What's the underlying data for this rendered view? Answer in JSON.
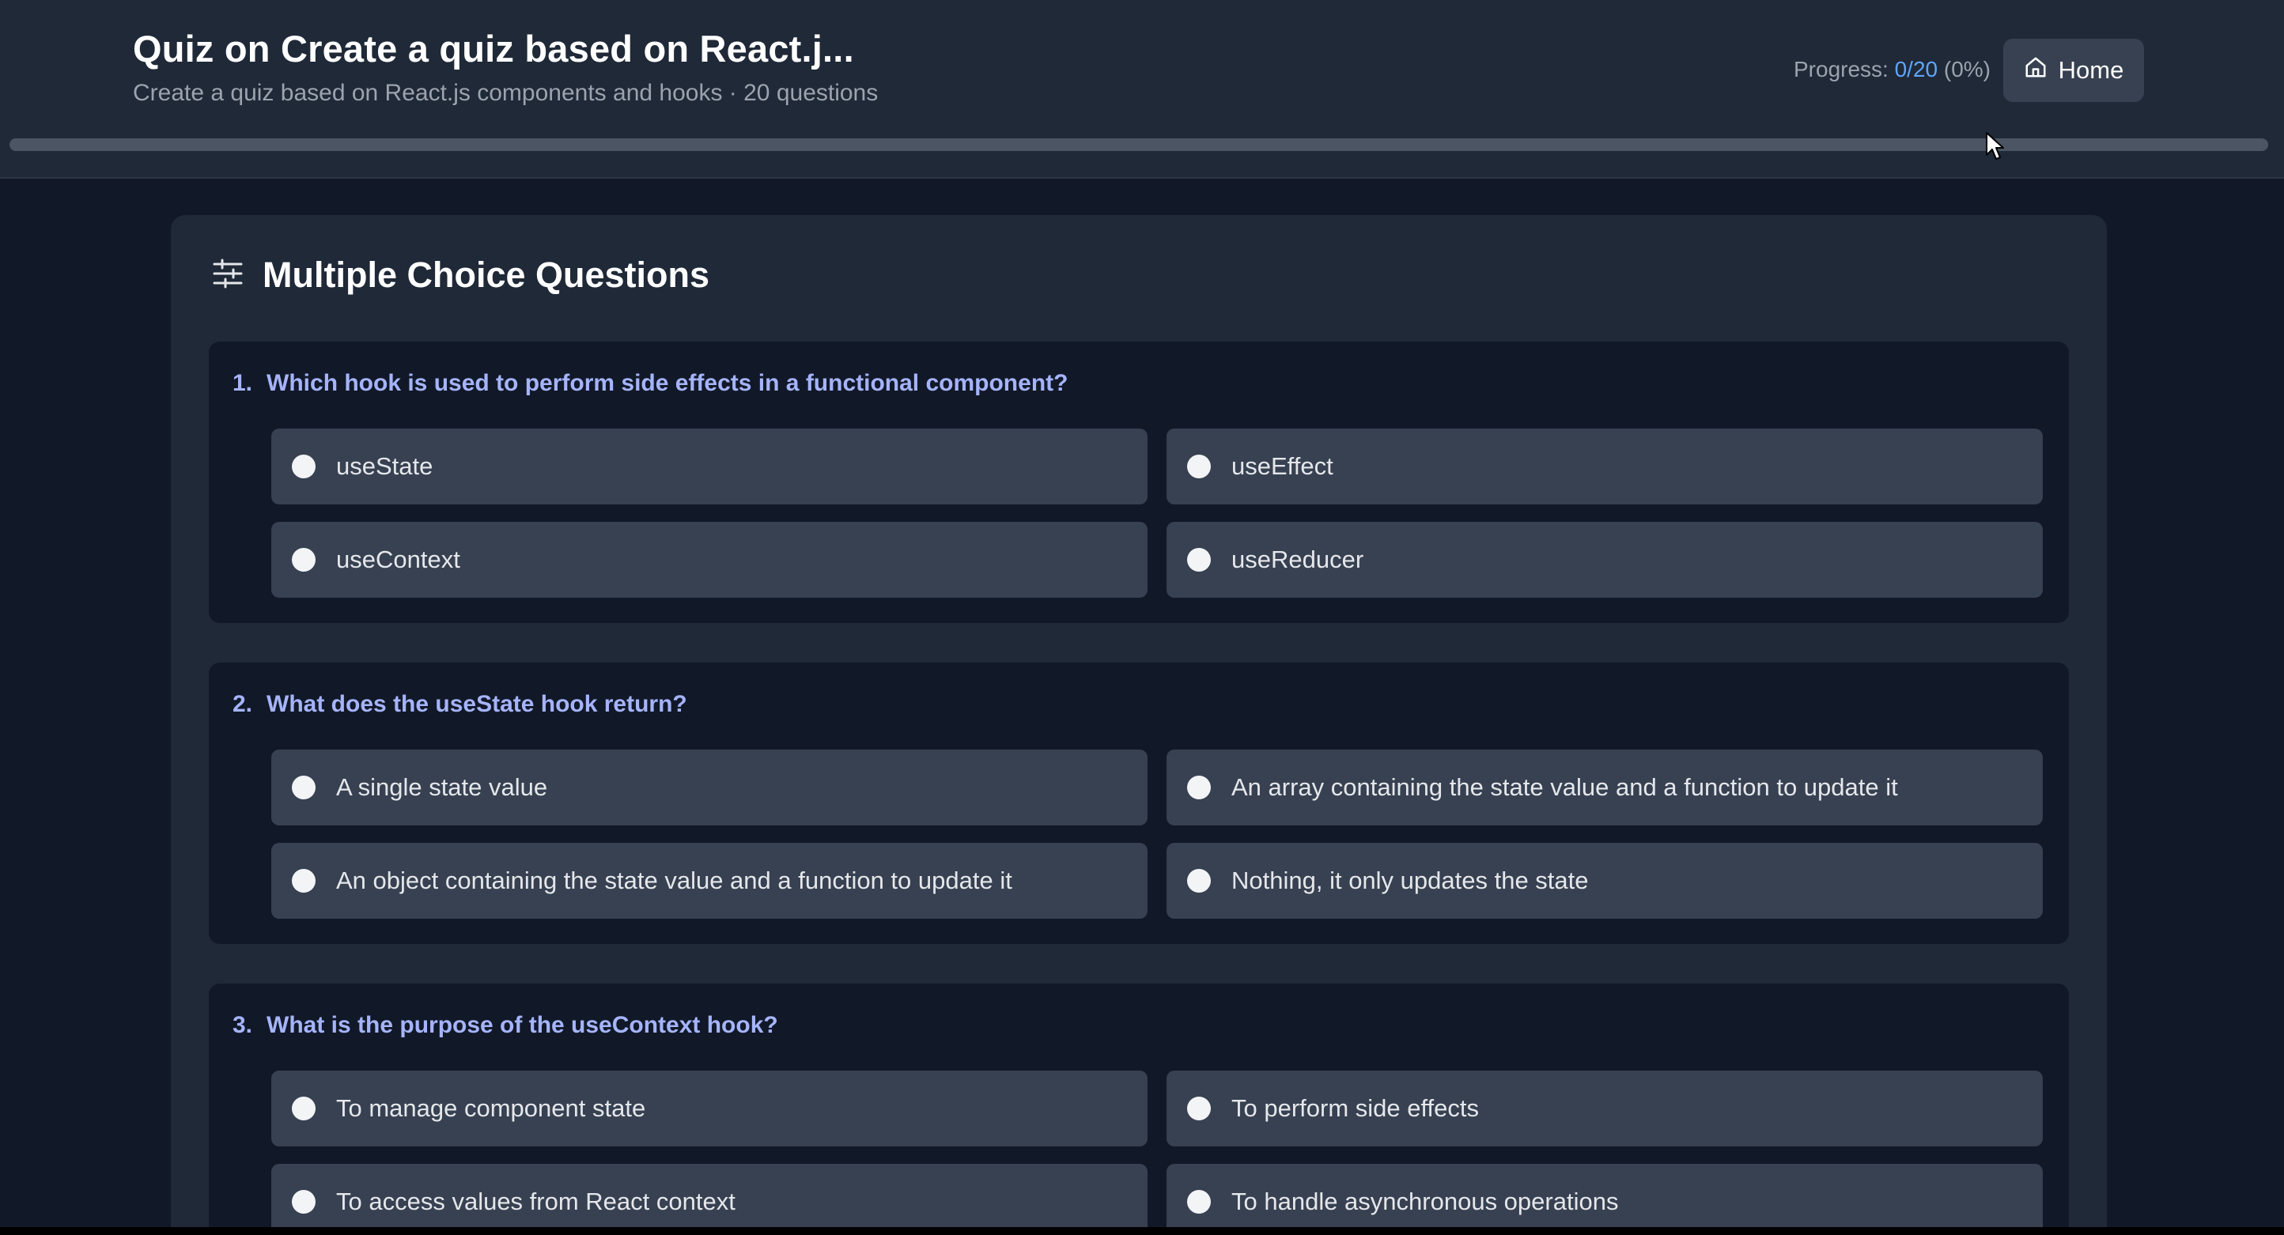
{
  "header": {
    "title": "Quiz on Create a quiz based on React.j...",
    "subtitle": "Create a quiz based on React.js components and hooks · 20 questions",
    "progress_label": "Progress:",
    "progress_count": "0/20",
    "progress_percent": "(0%)",
    "progress_fraction": 0,
    "home_label": "Home"
  },
  "section": {
    "title": "Multiple Choice Questions"
  },
  "questions": [
    {
      "number": "1.",
      "text": "Which hook is used to perform side effects in a functional component?",
      "options": [
        "useState",
        "useEffect",
        "useContext",
        "useReducer"
      ]
    },
    {
      "number": "2.",
      "text": "What does the useState hook return?",
      "options": [
        "A single state value",
        "An array containing the state value and a function to update it",
        "An object containing the state value and a function to update it",
        "Nothing, it only updates the state"
      ]
    },
    {
      "number": "3.",
      "text": "What is the purpose of the useContext hook?",
      "options": [
        "To manage component state",
        "To perform side effects",
        "To access values from React context",
        "To handle asynchronous operations"
      ]
    }
  ],
  "colors": {
    "background": "#111827",
    "panel": "#1f2937",
    "option": "#374151",
    "question_text": "#a5b4fc",
    "progress_accent": "#60a5fa"
  }
}
